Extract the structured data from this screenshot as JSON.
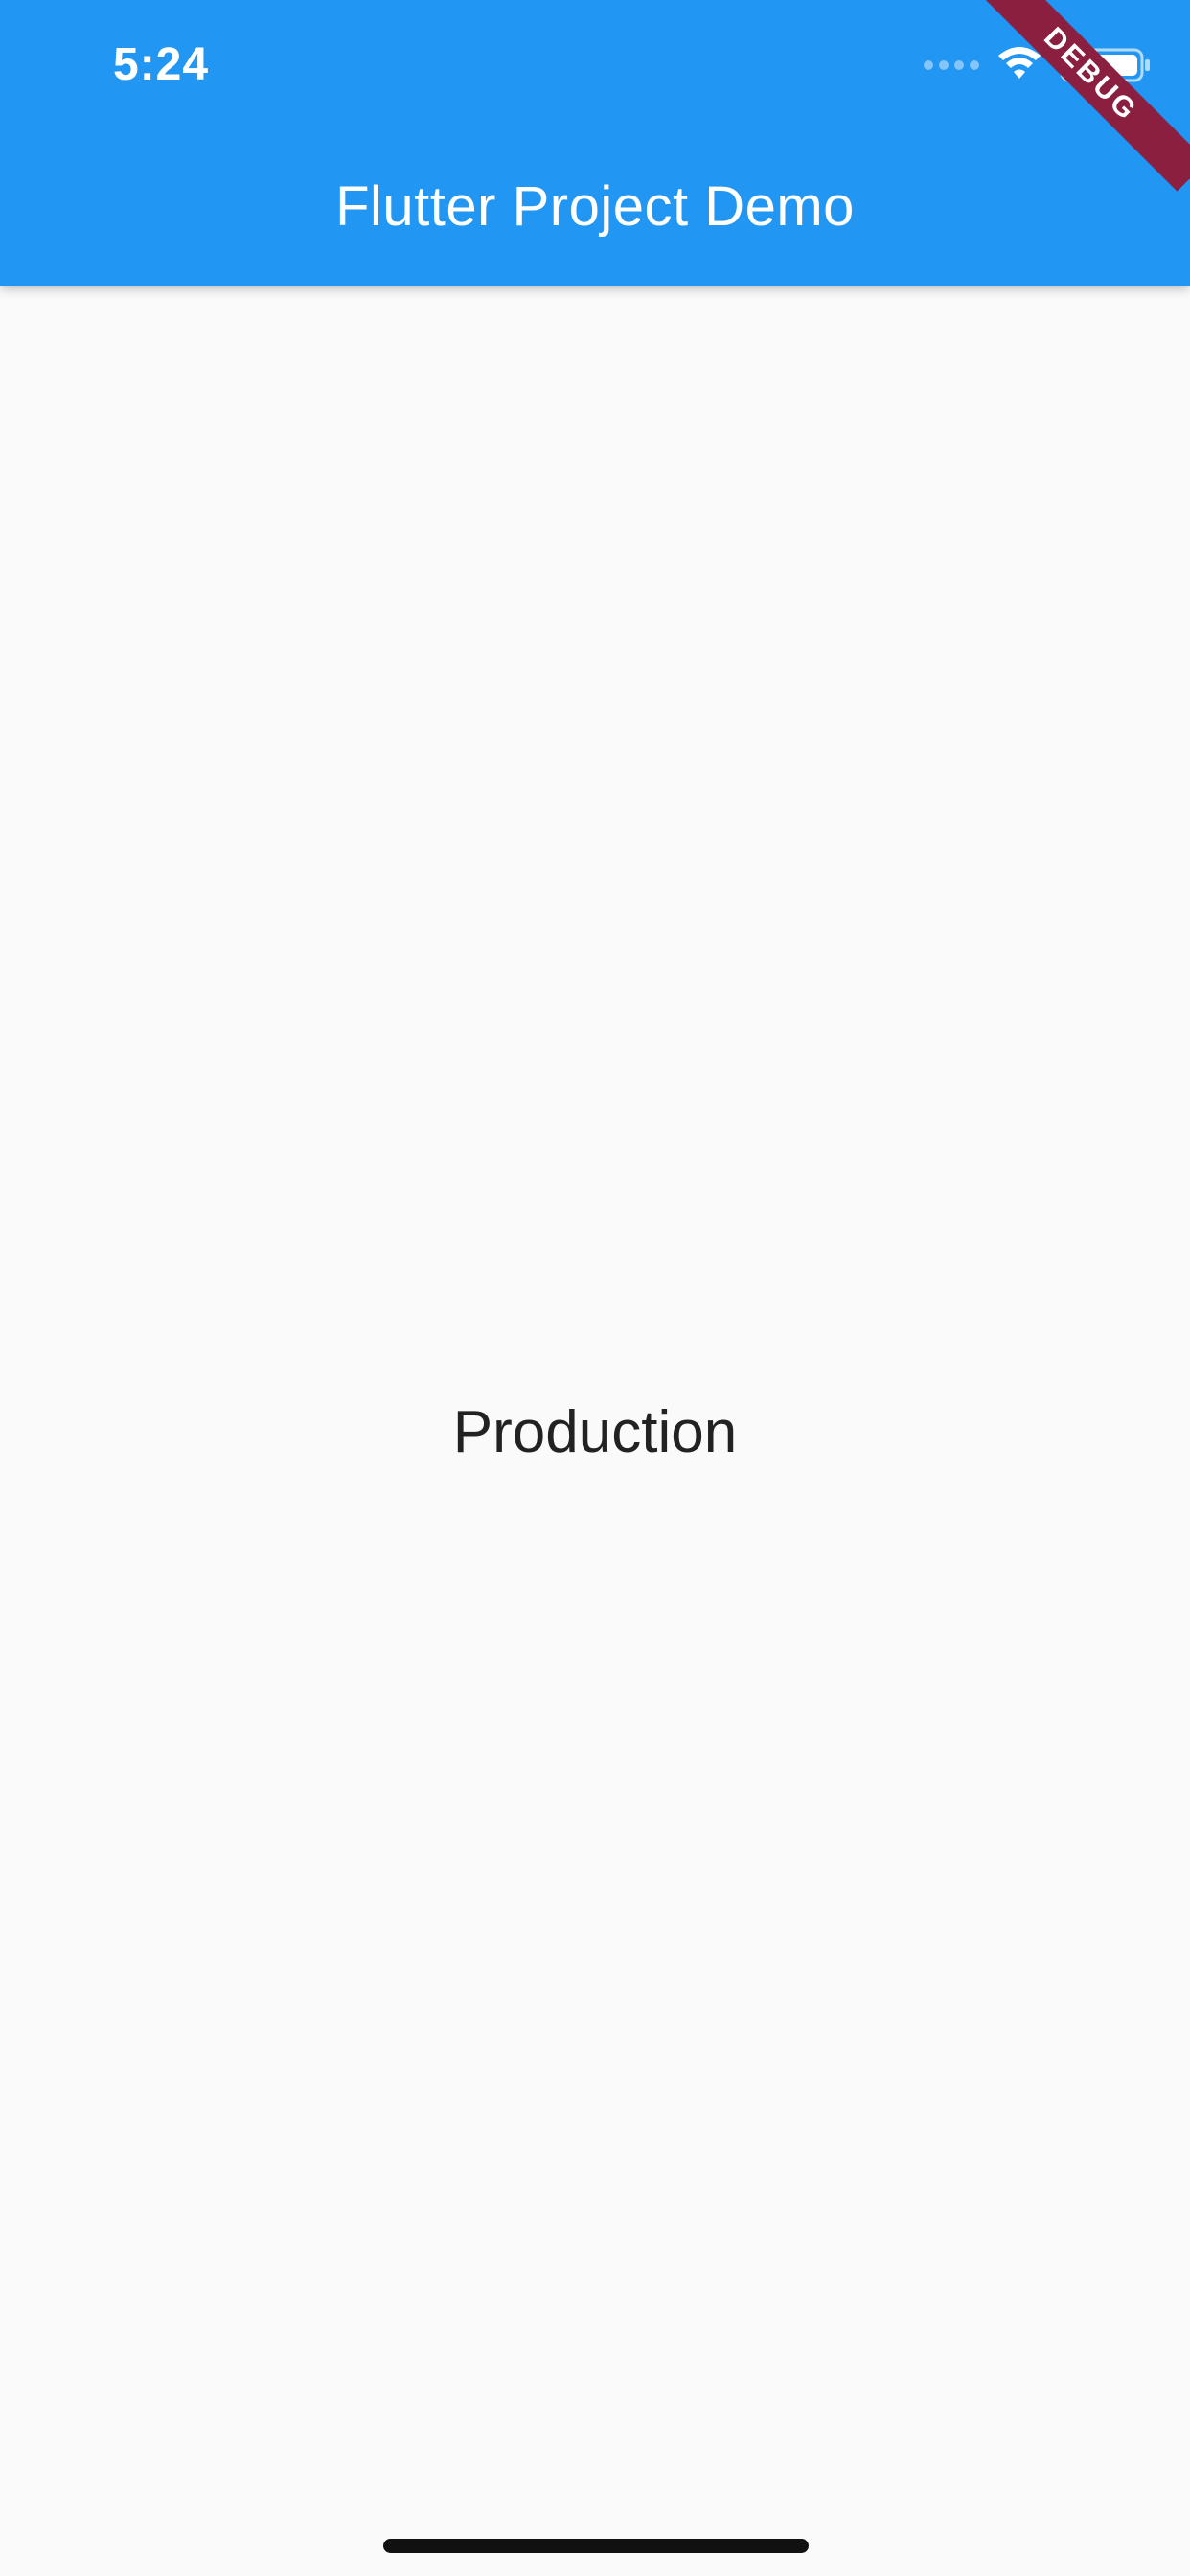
{
  "status_bar": {
    "time": "5:24",
    "icons": [
      "signal-dots-icon",
      "wifi-icon",
      "battery-icon"
    ]
  },
  "app_bar": {
    "title": "Flutter Project Demo",
    "color": "#2196f3"
  },
  "banner": {
    "label": "DEBUG",
    "color": "#8b1f3f"
  },
  "body": {
    "text": "Production",
    "background": "#fafafa"
  }
}
